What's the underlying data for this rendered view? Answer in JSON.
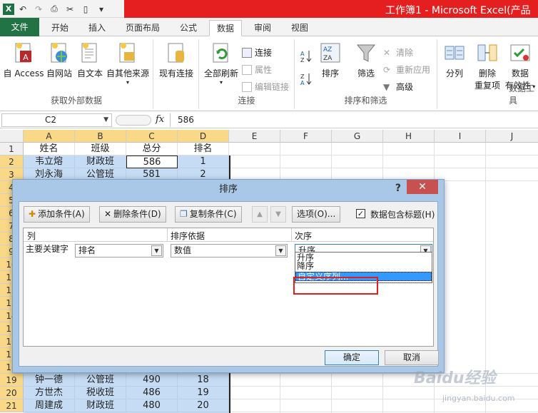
{
  "window": {
    "title": "工作簿1 - Microsoft Excel(产品",
    "qat_icons": [
      "excel-logo",
      "undo-icon",
      "redo-icon",
      "print-preview-icon",
      "tools-icon",
      "new-doc-icon",
      "qat-dropdown-icon"
    ]
  },
  "ribbon_tabs": [
    {
      "label": "文件"
    },
    {
      "label": "开始"
    },
    {
      "label": "插入"
    },
    {
      "label": "页面布局"
    },
    {
      "label": "公式"
    },
    {
      "label": "数据"
    },
    {
      "label": "审阅"
    },
    {
      "label": "视图"
    }
  ],
  "ribbon": {
    "external": {
      "label": "获取外部数据",
      "access": "自 Access",
      "web": "自网站",
      "text": "自文本",
      "other": "自其他来源",
      "existing": "现有连接"
    },
    "connections": {
      "label": "连接",
      "refresh_all": "全部刷新",
      "connections": "连接",
      "properties": "属性",
      "edit_links": "编辑链接"
    },
    "sortfilter": {
      "label": "排序和筛选",
      "sort": "排序",
      "filter": "筛选",
      "clear": "清除",
      "reapply": "重新应用",
      "advanced": "高级"
    },
    "tools": {
      "label": "数据工具",
      "split": "分列",
      "remove_dup_1": "删除",
      "remove_dup_2": "重复项",
      "validation_1": "数据",
      "validation_2": "有效性"
    }
  },
  "formula_bar": {
    "name_box": "C2",
    "fx": "fx",
    "value": "586"
  },
  "sheet": {
    "columns": [
      "A",
      "B",
      "C",
      "D",
      "E",
      "F",
      "G",
      "H",
      "I",
      "J"
    ],
    "row_numbers": [
      "1",
      "2",
      "3",
      "4",
      "5",
      "6",
      "7",
      "8",
      "9",
      "10",
      "11",
      "12",
      "13",
      "14",
      "15",
      "16",
      "17",
      "18",
      "19",
      "20",
      "21"
    ],
    "header_row": [
      "姓名",
      "班级",
      "总分",
      "排名"
    ],
    "top_rows": [
      [
        "韦立熔",
        "财政班",
        "586",
        "1"
      ],
      [
        "刘永海",
        "公管班",
        "581",
        "2"
      ]
    ],
    "bottom_rows": [
      [
        "钟一德",
        "公管班",
        "490",
        "18"
      ],
      [
        "方世杰",
        "税收班",
        "486",
        "19"
      ],
      [
        "周建成",
        "财政班",
        "480",
        "20"
      ]
    ]
  },
  "dialog": {
    "title": "排序",
    "help": "?",
    "close": "✕",
    "add_level": "添加条件(A)",
    "delete_level": "删除条件(D)",
    "copy_level": "复制条件(C)",
    "move_up": "▲",
    "move_down": "▼",
    "options": "选项(O)...",
    "has_headers": "数据包含标题(H)",
    "has_headers_checked": true,
    "col_header_column": "列",
    "col_header_sorton": "排序依据",
    "col_header_order": "次序",
    "row_label": "主要关键字",
    "key_value": "排名",
    "sorton_value": "数值",
    "order_value": "升序",
    "order_options": [
      "升序",
      "降序",
      "自定义序列..."
    ],
    "ok": "确定",
    "cancel": "取消"
  },
  "watermark": {
    "text": "Baidu经验",
    "url": "jingyan.baidu.com"
  }
}
